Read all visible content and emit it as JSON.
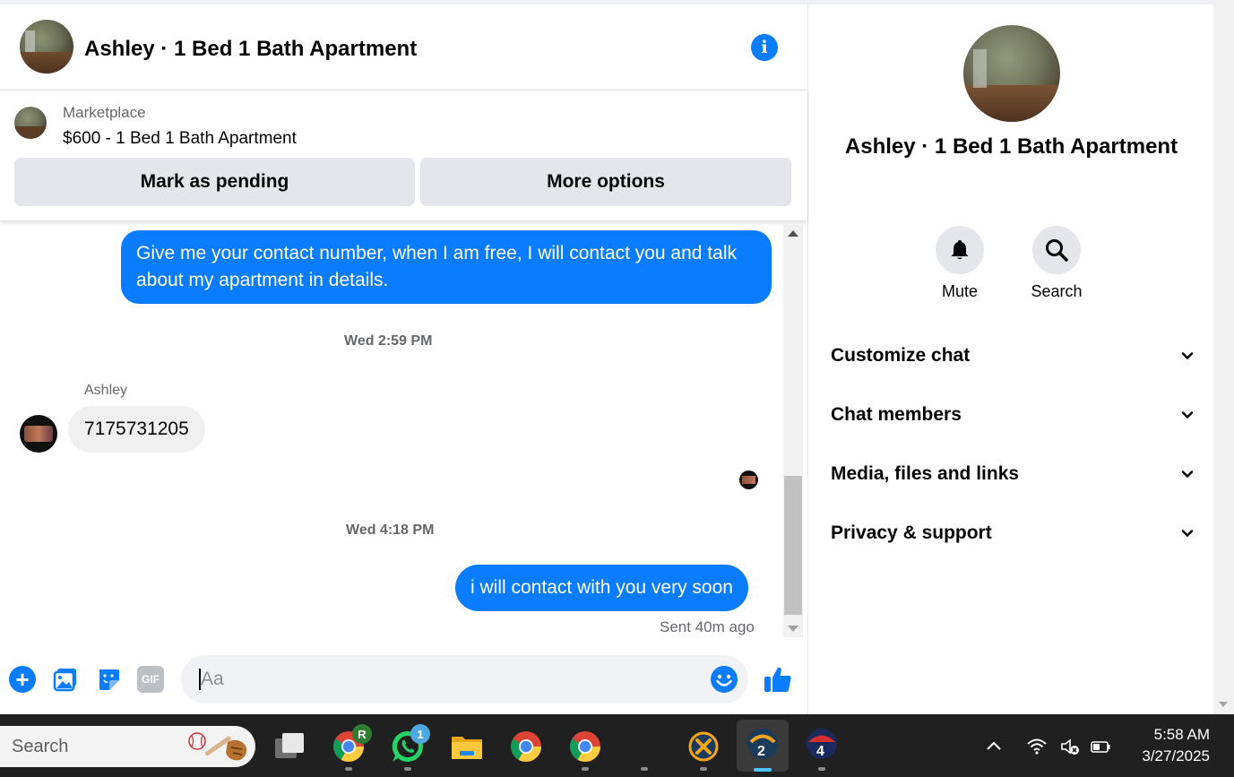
{
  "chat": {
    "title": "Ashley · 1 Bed 1 Bath Apartment",
    "listing": {
      "source": "Marketplace",
      "item": "$600 - 1 Bed 1 Bath Apartment",
      "mark_pending_label": "Mark as pending",
      "more_options_label": "More options"
    },
    "messages": [
      {
        "from": "me",
        "text": "Give me your contact number, when I am free, I will contact you and talk about my apartment in details."
      },
      {
        "type": "timestamp",
        "text": "Wed 2:59 PM"
      },
      {
        "from": "Ashley",
        "sender_label": "Ashley",
        "text": "7175731205"
      },
      {
        "type": "timestamp",
        "text": "Wed 4:18 PM"
      },
      {
        "from": "me",
        "text": "i will contact with you very soon",
        "status": "Sent 40m ago"
      }
    ],
    "composer": {
      "placeholder": "Aa",
      "gif_label": "GIF"
    }
  },
  "panel": {
    "title": "Ashley · 1 Bed 1 Bath Apartment",
    "mute_label": "Mute",
    "search_label": "Search",
    "sections": [
      "Customize chat",
      "Chat members",
      "Media, files and links",
      "Privacy & support"
    ]
  },
  "taskbar": {
    "search_text": "Search",
    "whatsapp_badge": "1",
    "chrome_profile_badge": "R",
    "workspace_active": "2",
    "workspace_other": "4",
    "time": "5:58 AM",
    "date": "3/27/2025"
  },
  "colors": {
    "accent": "#0a7cff",
    "bubble_in": "#f0f0f0",
    "button_bg": "#e4e6eb",
    "taskbar": "#202020"
  }
}
